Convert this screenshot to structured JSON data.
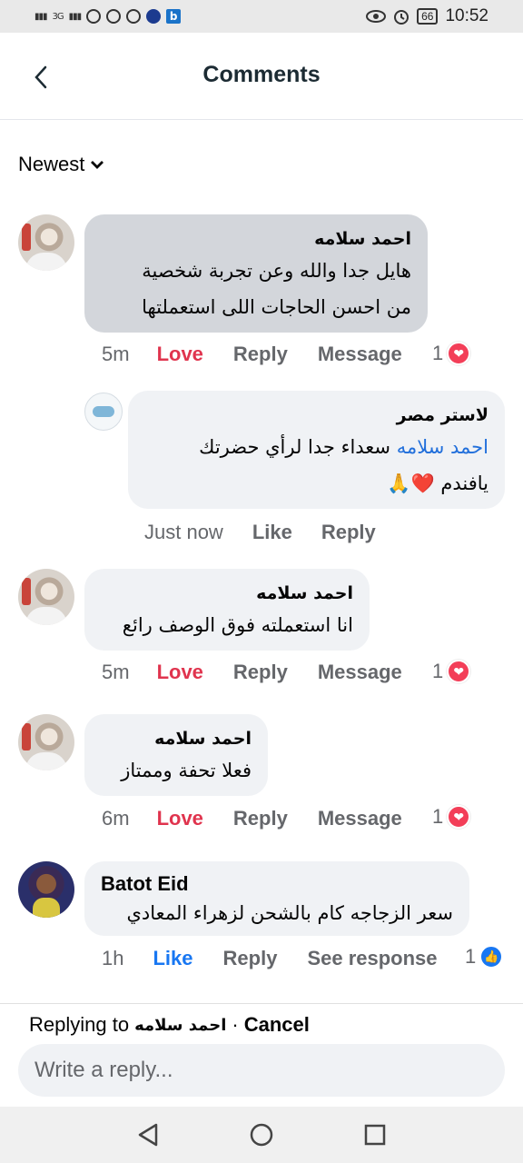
{
  "status_bar": {
    "network": "3G",
    "badge_letter": "b",
    "battery": "66",
    "time": "10:52"
  },
  "header": {
    "title": "Comments"
  },
  "sort": {
    "label": "Newest"
  },
  "comments": [
    {
      "author": "احمد سلامه",
      "lines": [
        "هايل جدا والله وعن تجربة شخصية",
        "من احسن الحاجات اللى استعملتها"
      ],
      "time": "5m",
      "reaction_label": "Love",
      "reply_label": "Reply",
      "message_label": "Message",
      "react_count": "1"
    },
    {
      "author": "لاستر مصر",
      "mention": "احمد سلامه",
      "line1_rest": " سعداء جدا لرأي حضرتك",
      "line2": "يافندم ❤️🙏",
      "time": "Just now",
      "like_label": "Like",
      "reply_label": "Reply"
    },
    {
      "author": "احمد سلامه",
      "lines": [
        "انا استعملته فوق الوصف رائع"
      ],
      "time": "5m",
      "reaction_label": "Love",
      "reply_label": "Reply",
      "message_label": "Message",
      "react_count": "1"
    },
    {
      "author": "احمد سلامه",
      "lines": [
        "فعلا تحفة وممتاز"
      ],
      "time": "6m",
      "reaction_label": "Love",
      "reply_label": "Reply",
      "message_label": "Message",
      "react_count": "1"
    },
    {
      "author": "Batot Eid",
      "lines": [
        "سعر الزجاجه كام بالشحن لزهراء المعادي"
      ],
      "time": "1h",
      "reaction_label": "Like",
      "reply_label": "Reply",
      "see_response_label": "See response",
      "react_count": "1"
    }
  ],
  "reply_bar": {
    "replying_to_label": "Replying to",
    "replying_to_name": "احمد سلامه",
    "separator": "·",
    "cancel_label": "Cancel",
    "placeholder": "Write a reply..."
  },
  "icons": {
    "heart": "❤",
    "thumb": "👍",
    "chevron": "⌄"
  },
  "colors": {
    "love": "#e0344e",
    "like": "#1877f2",
    "mention": "#216fdb"
  }
}
